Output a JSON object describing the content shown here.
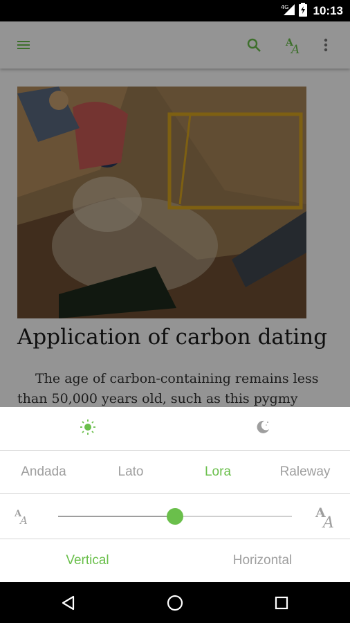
{
  "status_bar": {
    "network": "4G",
    "time": "10:13"
  },
  "toolbar": {
    "menu_icon": "hamburger-menu-icon",
    "search_icon": "search-icon",
    "text_settings_icon": "font-size-icon",
    "overflow_icon": "more-vert-icon"
  },
  "article": {
    "image_alt": "excavation photo",
    "title": "Application of carbon dating",
    "body": "The age of carbon-containing remains less than 50,000 years old, such as this pygmy"
  },
  "settings_panel": {
    "themes": [
      {
        "icon": "sun-icon",
        "active": true
      },
      {
        "icon": "moon-icon",
        "active": false
      }
    ],
    "fonts": [
      {
        "label": "Andada",
        "active": false
      },
      {
        "label": "Lato",
        "active": false
      },
      {
        "label": "Lora",
        "active": true
      },
      {
        "label": "Raleway",
        "active": false
      }
    ],
    "font_size": {
      "small_icon": "font-size-small-icon",
      "large_icon": "font-size-large-icon",
      "level_fraction": 0.5
    },
    "orientation": [
      {
        "label": "Vertical",
        "active": true
      },
      {
        "label": "Horizontal",
        "active": false
      }
    ]
  },
  "colors": {
    "accent": "#6abf4b",
    "inactive_text": "#9e9e9e"
  },
  "nav_bar": {
    "back_icon": "back-triangle-icon",
    "home_icon": "home-circle-icon",
    "recents_icon": "recents-square-icon"
  }
}
